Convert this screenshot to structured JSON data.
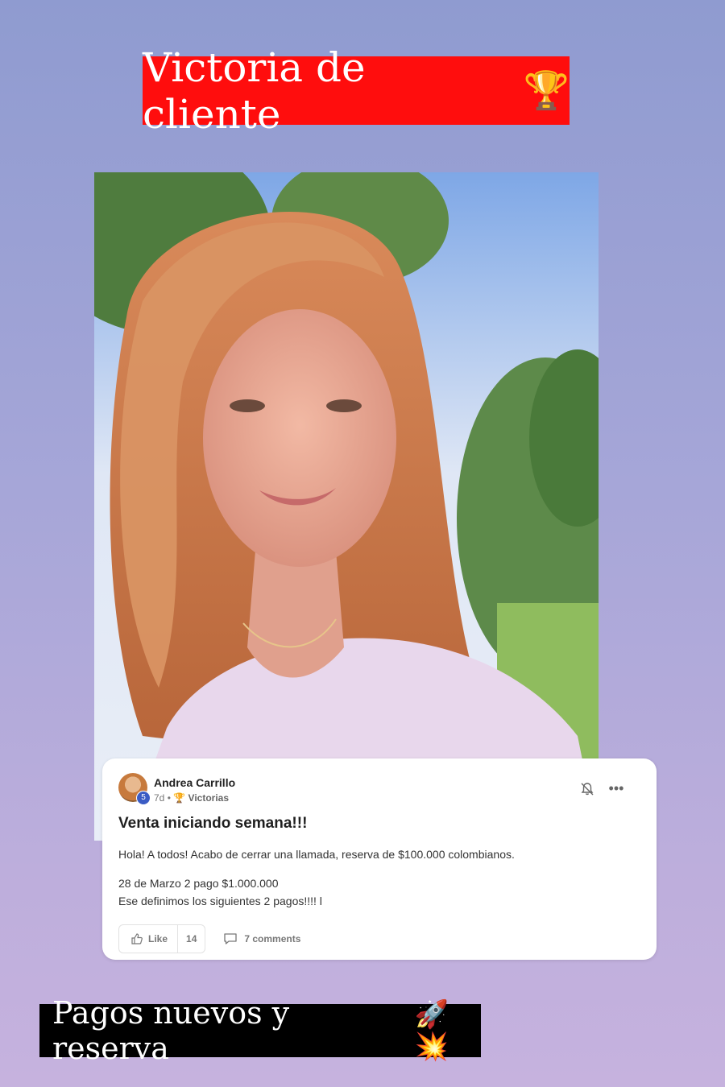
{
  "top_banner": {
    "text": "Victoria de cliente",
    "emoji": "🏆"
  },
  "photo": {
    "description_icon": "selfie-photo"
  },
  "post": {
    "author": "Andrea Carrillo",
    "level": "5",
    "time": "7d",
    "separator": "•",
    "category_icon": "🏆",
    "category": "Victorias",
    "title": "Venta iniciando semana!!!",
    "paragraph1": "Hola! A todos! Acabo de cerrar una llamada, reserva de $100.000 colombianos.",
    "paragraph2_line1": "28 de Marzo 2 pago $1.000.000",
    "paragraph2_line2": "Ese definimos los siguientes 2 pagos!!!! l",
    "like_label": "Like",
    "like_count": "14",
    "comments_label": "7 comments",
    "more_label": "•••"
  },
  "bottom_banner": {
    "text": "Pagos nuevos y reserva",
    "emoji": "🚀💥"
  }
}
